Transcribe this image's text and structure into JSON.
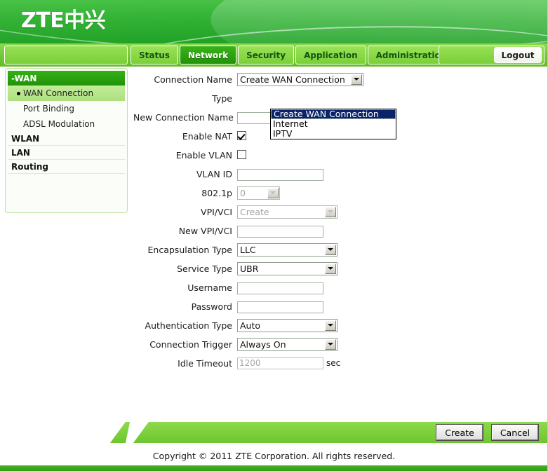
{
  "header": {
    "logo_text": "ZTE中兴"
  },
  "nav": {
    "tabs": [
      {
        "label": "Status",
        "active": false
      },
      {
        "label": "Network",
        "active": true
      },
      {
        "label": "Security",
        "active": false
      },
      {
        "label": "Application",
        "active": false
      },
      {
        "label": "Administration",
        "active": false
      }
    ],
    "logout_label": "Logout"
  },
  "sidebar": {
    "group_title": "-WAN",
    "sub_items": [
      {
        "label": "WAN Connection",
        "selected": true
      },
      {
        "label": "Port Binding",
        "selected": false
      },
      {
        "label": "ADSL Modulation",
        "selected": false
      }
    ],
    "groups": [
      {
        "label": "WLAN"
      },
      {
        "label": "LAN"
      },
      {
        "label": "Routing"
      }
    ]
  },
  "form": {
    "connection_name": {
      "label": "Connection Name",
      "value": "Create WAN Connection",
      "open": true,
      "options": [
        "Create WAN Connection",
        "Internet",
        "IPTV"
      ],
      "selected_option": "Create WAN Connection"
    },
    "type": {
      "label": "Type",
      "value": ""
    },
    "new_connection_name": {
      "label": "New Connection Name",
      "value": ""
    },
    "enable_nat": {
      "label": "Enable NAT",
      "checked": true
    },
    "enable_vlan": {
      "label": "Enable VLAN",
      "checked": false
    },
    "vlan_id": {
      "label": "VLAN ID",
      "value": ""
    },
    "dot1p": {
      "label": "802.1p",
      "value": "0",
      "disabled": true
    },
    "vpi_vci": {
      "label": "VPI/VCI",
      "value": "Create",
      "disabled": true
    },
    "new_vpi_vci": {
      "label": "New VPI/VCI",
      "value": ""
    },
    "encapsulation_type": {
      "label": "Encapsulation Type",
      "value": "LLC"
    },
    "service_type": {
      "label": "Service Type",
      "value": "UBR"
    },
    "username": {
      "label": "Username",
      "value": ""
    },
    "password": {
      "label": "Password",
      "value": ""
    },
    "authentication_type": {
      "label": "Authentication Type",
      "value": "Auto"
    },
    "connection_trigger": {
      "label": "Connection Trigger",
      "value": "Always On"
    },
    "idle_timeout": {
      "label": "Idle Timeout",
      "value": "1200",
      "unit": "sec",
      "disabled": true
    }
  },
  "actions": {
    "create_label": "Create",
    "cancel_label": "Cancel"
  },
  "footer": {
    "copyright": "Copyright © 2011 ZTE Corporation. All rights reserved."
  },
  "colors": {
    "banner_green": "#1fae20",
    "nav_green": "#7ed03c",
    "active_tab_green": "#2da50f",
    "sidebar_head_green": "#2aa30d",
    "selected_item_green": "#b9e78e",
    "dropdown_highlight": "#0a246a"
  }
}
